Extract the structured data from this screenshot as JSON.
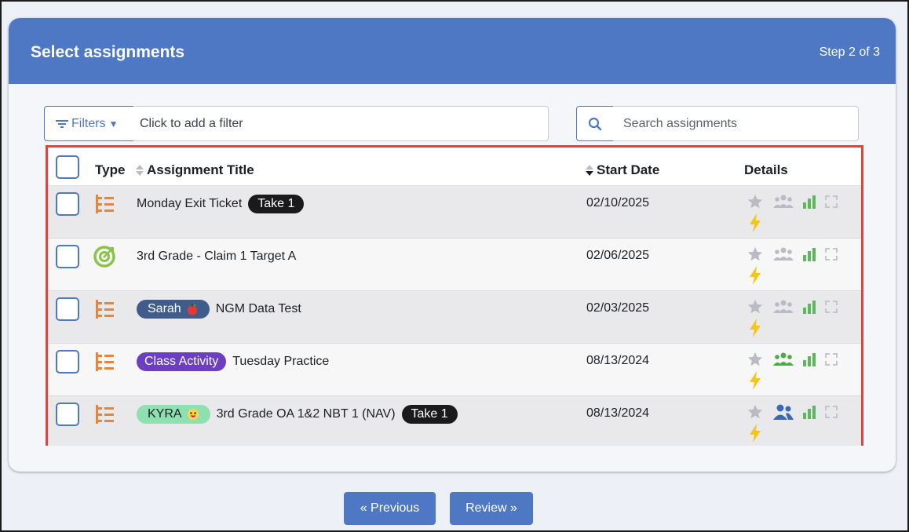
{
  "header": {
    "title": "Select assignments",
    "step": "Step 2 of 3"
  },
  "filters": {
    "button_label": "Filters",
    "placeholder": "Click to add a filter"
  },
  "search": {
    "placeholder": "Search assignments"
  },
  "table": {
    "columns": {
      "type": "Type",
      "title": "Assignment Title",
      "start_date": "Start Date",
      "details": "Details"
    },
    "rows": [
      {
        "type_icon": "list-icon",
        "pre_badge": "",
        "title": "Monday Exit Ticket",
        "post_badge": "Take 1",
        "date": "02/10/2025",
        "group_color": "#b9bcc4"
      },
      {
        "type_icon": "target-icon",
        "pre_badge": "",
        "title": "3rd Grade - Claim 1 Target A",
        "post_badge": "",
        "date": "02/06/2025",
        "group_color": "#b9bcc4"
      },
      {
        "type_icon": "list-icon",
        "pre_badge": "Sarah",
        "title": "NGM Data Test",
        "post_badge": "",
        "date": "02/03/2025",
        "group_color": "#b9bcc4"
      },
      {
        "type_icon": "list-icon",
        "pre_badge": "Class Activity",
        "title": "Tuesday Practice",
        "post_badge": "",
        "date": "08/13/2024",
        "group_color": "#4fa94a"
      },
      {
        "type_icon": "list-icon",
        "pre_badge": "KYRA",
        "title": "3rd Grade OA 1&2 NBT 1 (NAV)",
        "post_badge": "Take 1",
        "date": "08/13/2024",
        "group_color": "#3d68b8"
      }
    ]
  },
  "footer": {
    "previous_label": "« Previous",
    "review_label": "Review »"
  },
  "colors": {
    "primary": "#4f78c4",
    "highlight_border": "#e2433b",
    "list_icon": "#e8853d",
    "target_icon": "#8bc34a",
    "chart_icon": "#5cb85c",
    "bolt_icon": "#f5c518"
  }
}
